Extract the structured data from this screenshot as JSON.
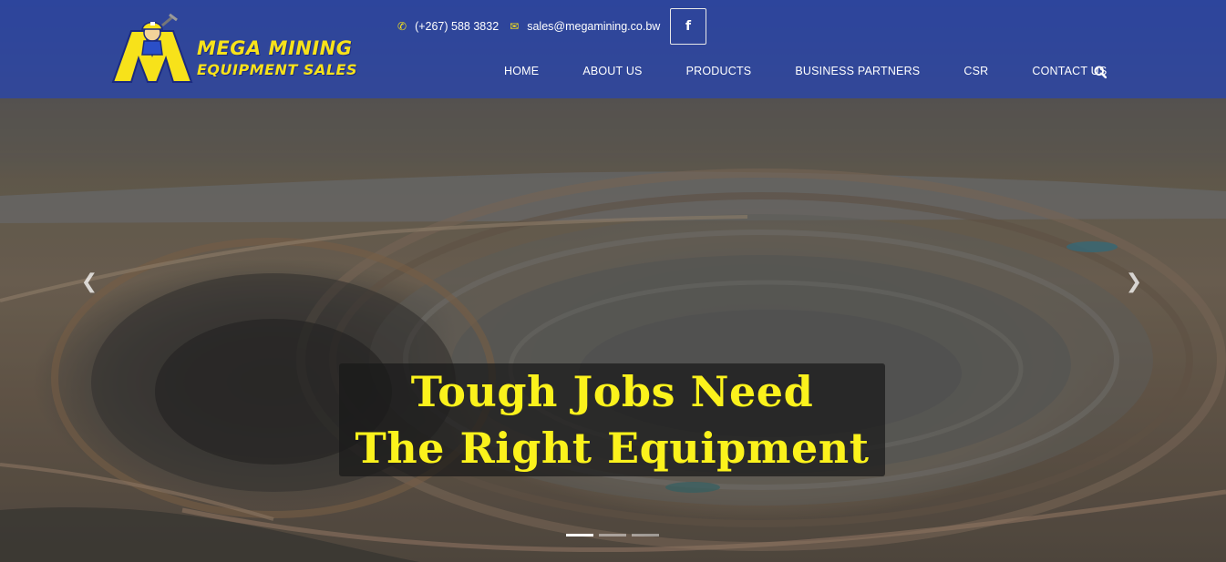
{
  "brand": {
    "line1": "MEGA MINING",
    "line2": "EQUIPMENT SALES"
  },
  "contact": {
    "phone_icon": "phone-icon",
    "phone": "(+267) 588 3832",
    "email_icon": "envelope-icon",
    "email": "sales@megamining.co.bw",
    "social": "f"
  },
  "nav": {
    "items": [
      {
        "label": "HOME"
      },
      {
        "label": "ABOUT US"
      },
      {
        "label": "PRODUCTS"
      },
      {
        "label": "BUSINESS PARTNERS"
      },
      {
        "label": "CSR"
      },
      {
        "label": "CONTACT US"
      }
    ],
    "search_icon": "search-icon"
  },
  "hero": {
    "headline_line1": "Tough Jobs Need",
    "headline_line2": "The Right Equipment",
    "prev_icon": "chevron-left-icon",
    "next_icon": "chevron-right-icon",
    "slides": 3,
    "active_slide": 1
  },
  "colors": {
    "header": "#2c46aa",
    "accent_yellow": "#fbf21c"
  }
}
